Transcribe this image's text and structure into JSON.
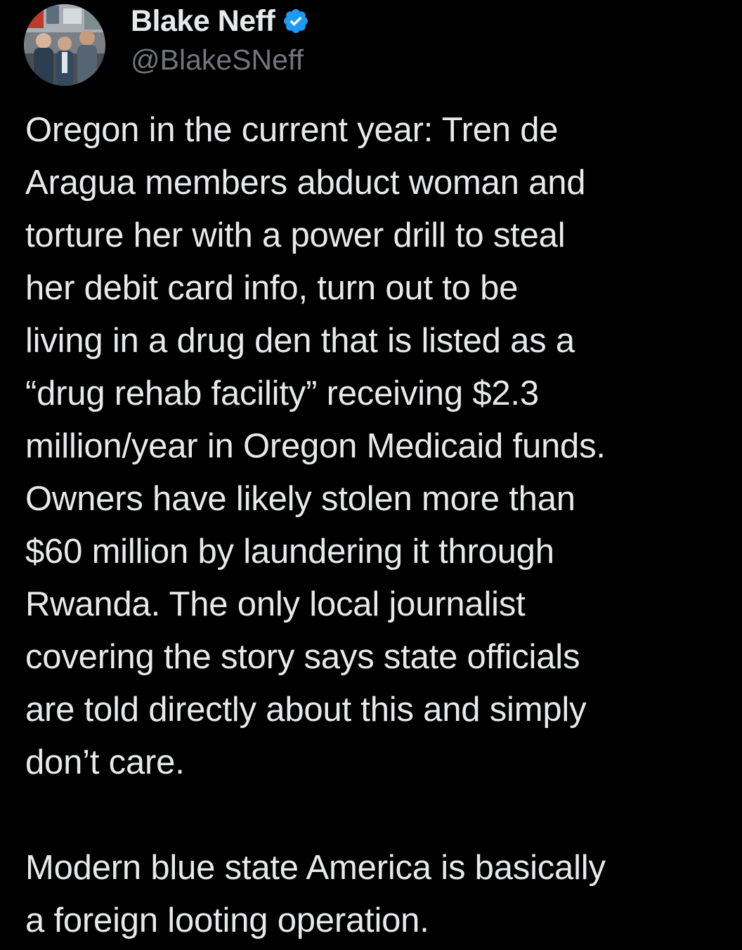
{
  "author": {
    "display_name": "Blake Neff",
    "handle": "@BlakeSNeff",
    "verified_icon": "verified-badge-icon",
    "verified_color": "#1d9bf0"
  },
  "tweet": {
    "paragraph_1": "Oregon in the current year: Tren de\nAragua members abduct woman and\ntorture her with a power drill to steal\nher debit card info, turn out to be\nliving in a drug den that is listed as a\n“drug rehab facility” receiving $2.3\nmillion/year in Oregon Medicaid funds.\nOwners have likely stolen more than\n$60 million by laundering it through\nRwanda. The only local journalist\ncovering the story says state officials\nare told directly about this and simply\ndon’t care.",
    "paragraph_2": "Modern blue state America is basically\na foreign looting operation."
  },
  "colors": {
    "background": "#000000",
    "text_primary": "#e7e9ea",
    "text_secondary": "#71767b"
  }
}
